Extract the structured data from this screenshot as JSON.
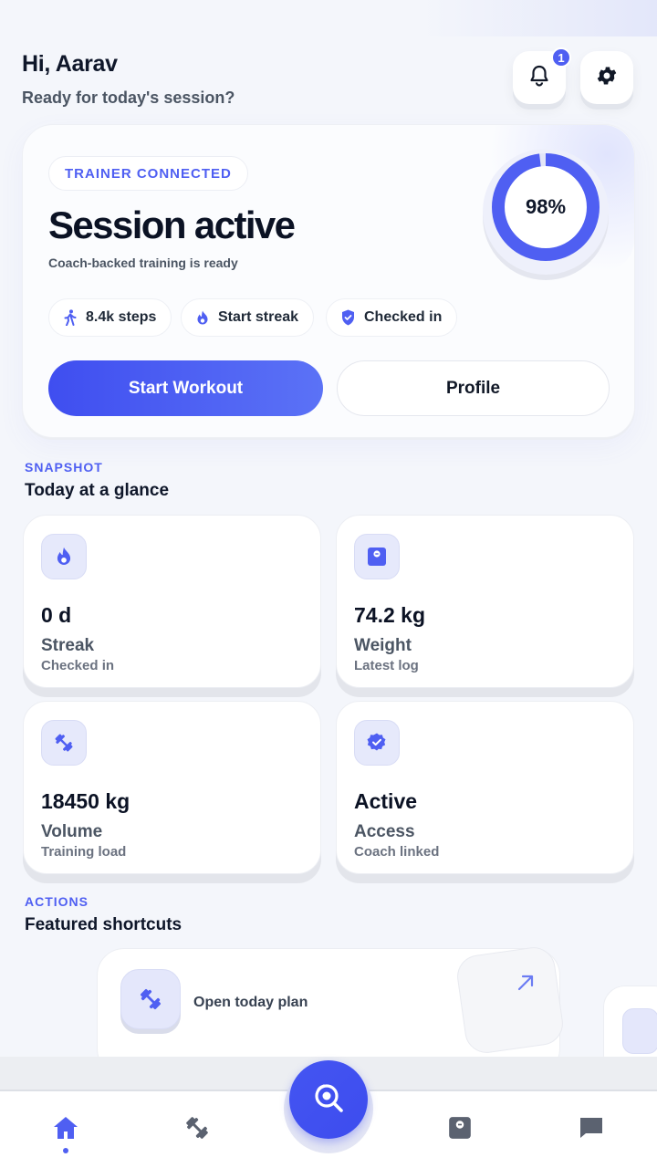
{
  "header": {
    "greeting": "Hi, Aarav",
    "subtitle": "Ready for today's session?",
    "notification_count": "1"
  },
  "hero": {
    "chip": "TRAINER CONNECTED",
    "title": "Session active",
    "subtitle": "Coach-backed training is ready",
    "progress_label": "98%",
    "progress_value": 0.98,
    "chips": {
      "steps": "8.4k steps",
      "streak": "Start streak",
      "checked": "Checked in"
    },
    "primary_button": "Start Workout",
    "secondary_button": "Profile"
  },
  "snapshot": {
    "kicker": "SNAPSHOT",
    "title": "Today at a glance",
    "cards": [
      {
        "value": "0 d",
        "label": "Streak",
        "sub": "Checked in",
        "icon": "flame-icon"
      },
      {
        "value": "74.2 kg",
        "label": "Weight",
        "sub": "Latest log",
        "icon": "scale-icon"
      },
      {
        "value": "18450 kg",
        "label": "Volume",
        "sub": "Training load",
        "icon": "dumbbell-icon"
      },
      {
        "value": "Active",
        "label": "Access",
        "sub": "Coach linked",
        "icon": "verified-badge-icon"
      }
    ]
  },
  "actions": {
    "kicker": "ACTIONS",
    "title": "Featured shortcuts",
    "shortcut_label": "Open today plan"
  },
  "nav": {
    "items": [
      "home-icon",
      "dumbbell-icon",
      "search-icon",
      "scale-icon",
      "chat-icon"
    ]
  },
  "colors": {
    "accent": "#4f5ff2",
    "text": "#0f172a",
    "background": "#f4f6fb"
  }
}
